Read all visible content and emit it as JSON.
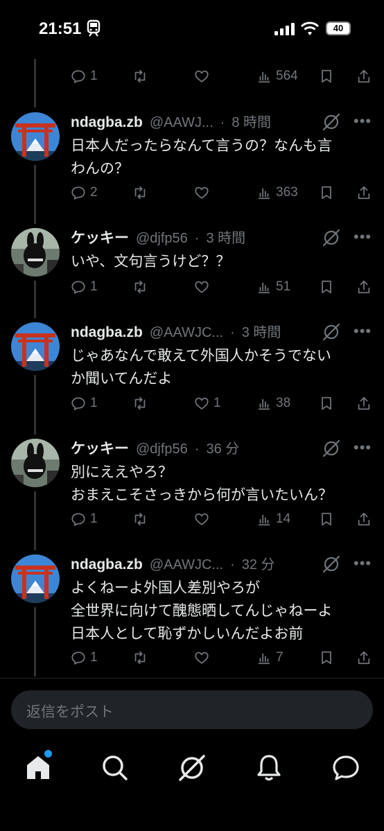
{
  "status_bar": {
    "time": "21:51",
    "battery": "40"
  },
  "tweets": [
    {
      "name": "ndagba.zb",
      "handle": "@AAWJ...",
      "age": "8 時間",
      "text": "日本人だったらなんて言うの？なんも言\nわんの？",
      "replies": "2",
      "retweets": "",
      "likes": "",
      "views": "363",
      "avatar": "torii"
    },
    {
      "name": "ケッキー",
      "handle": "@djfp56",
      "age": "3 時間",
      "text": "いや、文句言うけど？？",
      "replies": "1",
      "retweets": "",
      "likes": "",
      "views": "51",
      "avatar": "photo"
    },
    {
      "name": "ndagba.zb",
      "handle": "@AAWJC...",
      "age": "3 時間",
      "text": "じゃあなんで敢えて外国人かそうでない\nか聞いてんだよ",
      "replies": "1",
      "retweets": "",
      "likes": "1",
      "views": "38",
      "avatar": "torii"
    },
    {
      "name": "ケッキー",
      "handle": "@djfp56",
      "age": "36 分",
      "text": "別にええやろ？\nおまえこそさっきから何が言いたいん？",
      "replies": "1",
      "retweets": "",
      "likes": "",
      "views": "14",
      "avatar": "photo"
    },
    {
      "name": "ndagba.zb",
      "handle": "@AAWJC...",
      "age": "32 分",
      "text": "よくねーよ外国人差別やろが\n全世界に向けて醜態晒してんじゃねーよ\n日本人として恥ずかしいんだよお前",
      "replies": "1",
      "retweets": "",
      "likes": "",
      "views": "7",
      "avatar": "torii"
    }
  ],
  "top_actions": {
    "replies": "1",
    "retweets": "",
    "likes": "",
    "views": "564"
  },
  "reply_placeholder": "返信をポスト",
  "colors": {
    "background": "#000000",
    "text": "#e7e9ea",
    "muted": "#71767b",
    "accent": "#1d9bf0"
  }
}
